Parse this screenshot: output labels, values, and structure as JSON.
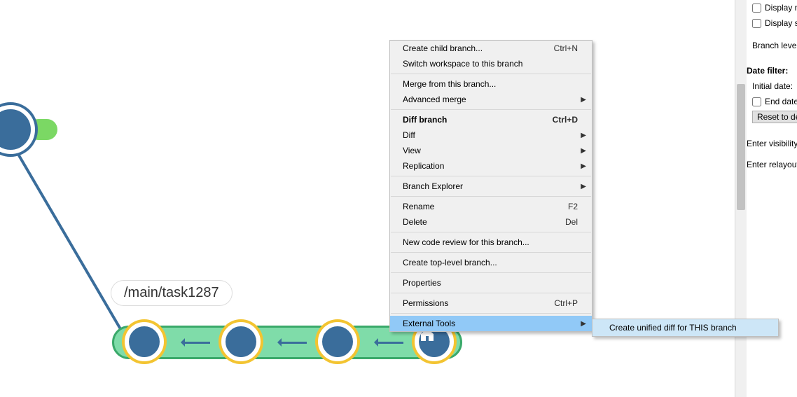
{
  "branch": {
    "label": "/main/task1287"
  },
  "context_menu": {
    "create_child": "Create child branch...",
    "create_child_shortcut": "Ctrl+N",
    "switch_workspace": "Switch workspace to this branch",
    "merge_from": "Merge from this branch...",
    "advanced_merge": "Advanced merge",
    "diff_branch": "Diff branch",
    "diff_branch_shortcut": "Ctrl+D",
    "diff": "Diff",
    "view": "View",
    "replication": "Replication",
    "branch_explorer": "Branch Explorer",
    "rename": "Rename",
    "rename_shortcut": "F2",
    "delete": "Delete",
    "delete_shortcut": "Del",
    "new_code_review": "New code review for this branch...",
    "create_top_level": "Create top-level branch...",
    "properties": "Properties",
    "permissions": "Permissions",
    "permissions_shortcut": "Ctrl+P",
    "external_tools": "External Tools"
  },
  "submenu": {
    "unified_diff": "Create unified diff for THIS branch"
  },
  "sidepanel": {
    "display_m": "Display m",
    "display_s": "Display s",
    "branch_levels": "Branch level:",
    "date_filter": "Date filter:",
    "initial_date": "Initial date:",
    "end_date": "End date",
    "reset_btn": "Reset to de",
    "enter_visibility": "Enter visibility",
    "enter_relayout": "Enter relayout"
  }
}
